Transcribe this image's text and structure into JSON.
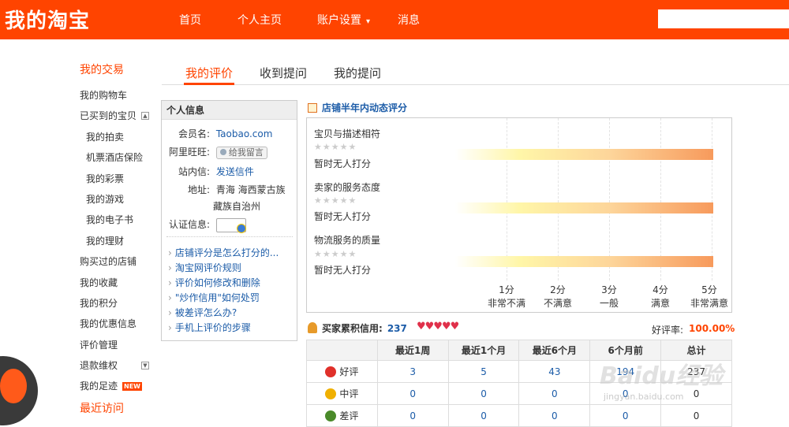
{
  "header": {
    "logo": "我的淘宝",
    "nav": [
      "首页",
      "个人主页",
      "账户设置",
      "消息"
    ]
  },
  "sidebar": {
    "items": [
      {
        "label": "我的交易",
        "type": "heading"
      },
      {
        "label": "我的购物车"
      },
      {
        "label": "已买到的宝贝",
        "collapse": "▲"
      },
      {
        "label": "我的拍卖",
        "sub": true
      },
      {
        "label": "机票酒店保险",
        "sub": true
      },
      {
        "label": "我的彩票",
        "sub": true
      },
      {
        "label": "我的游戏",
        "sub": true
      },
      {
        "label": "我的电子书",
        "sub": true
      },
      {
        "label": "我的理财",
        "sub": true
      },
      {
        "label": "购买过的店铺"
      },
      {
        "label": "我的收藏"
      },
      {
        "label": "我的积分"
      },
      {
        "label": "我的优惠信息"
      },
      {
        "label": "评价管理"
      },
      {
        "label": "退款维权",
        "collapse": "▼"
      },
      {
        "label": "我的足迹",
        "badge": "NEW"
      },
      {
        "label": "最近访问",
        "type": "heading"
      }
    ]
  },
  "tabs": [
    "我的评价",
    "收到提问",
    "我的提问"
  ],
  "profile": {
    "title": "个人信息",
    "member_label": "会员名:",
    "member_value": "Taobao.com",
    "wangwang_label": "阿里旺旺:",
    "wangwang_button": "给我留言",
    "mail_label": "站内信:",
    "mail_link": "发送信件",
    "address_label": "地址:",
    "address_line1": "青海  海西蒙古族",
    "address_line2": "藏族自治州",
    "cert_label": "认证信息:",
    "links": [
      "店铺评分是怎么打分的...",
      "淘宝网评价规则",
      "评价如何修改和删除",
      "\"炒作信用\"如何处罚",
      "被差评怎么办?",
      "手机上评价的步骤"
    ]
  },
  "dsr": {
    "title": "店铺半年内动态评分",
    "criteria": [
      {
        "label": "宝贝与描述相符",
        "stars": "★★★★★",
        "status": "暂时无人打分"
      },
      {
        "label": "卖家的服务态度",
        "stars": "★★★★★",
        "status": "暂时无人打分"
      },
      {
        "label": "物流服务的质量",
        "stars": "★★★★★",
        "status": "暂时无人打分"
      }
    ],
    "scale": [
      {
        "score": "1分",
        "desc": "非常不满"
      },
      {
        "score": "2分",
        "desc": "不满意"
      },
      {
        "score": "3分",
        "desc": "一般"
      },
      {
        "score": "4分",
        "desc": "满意"
      },
      {
        "score": "5分",
        "desc": "非常满意"
      }
    ]
  },
  "buyer": {
    "label": "买家累积信用:",
    "score": "237",
    "hearts": "♥♥♥♥♥",
    "good_rate_label": "好评率:",
    "good_rate": "100.00%"
  },
  "table": {
    "headers": [
      "",
      "最近1周",
      "最近1个月",
      "最近6个月",
      "6个月前",
      "总计"
    ],
    "rows": [
      {
        "label": "好评",
        "icon": "good-icon",
        "color": "#e0302a",
        "values": [
          "3",
          "5",
          "43",
          "194",
          "237"
        ]
      },
      {
        "label": "中评",
        "icon": "neutral-icon",
        "color": "#f0b000",
        "values": [
          "0",
          "0",
          "0",
          "0",
          "0"
        ]
      },
      {
        "label": "差评",
        "icon": "bad-icon",
        "color": "#4a8a2a",
        "values": [
          "0",
          "0",
          "0",
          "0",
          "0"
        ]
      }
    ]
  },
  "watermark": {
    "text": "Baidu经验",
    "sub": "jingyan.baidu.com"
  }
}
